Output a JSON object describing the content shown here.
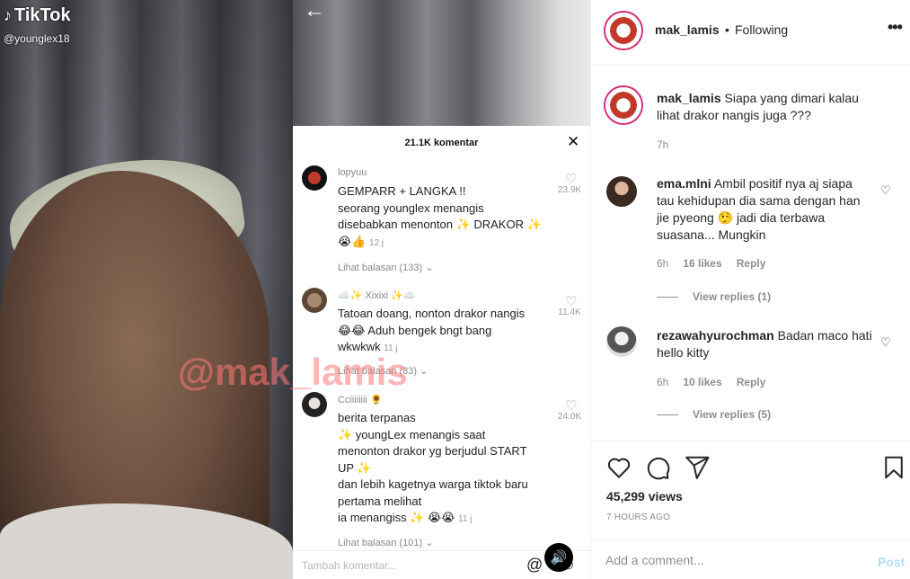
{
  "media": {
    "tiktok": {
      "logo_text": "TikTok",
      "handle": "@younglex18"
    },
    "watermark": "@mak_lamis",
    "comments_panel": {
      "title": "21.1K komentar",
      "close_icon": "close-icon",
      "comments": [
        {
          "username": "lopyuu",
          "lines": [
            "GEMPARR + LANGKA !!",
            "seorang younglex menangis",
            "disebabkan menonton ✨ DRAKOR ✨"
          ],
          "emoji_line": "😭👍",
          "time": "12 j",
          "likes": "23.9K",
          "replies": "Lihat balasan (133)",
          "avatar_color": "#c0392b"
        },
        {
          "username": "☁️✨ Xixixi ✨☁️",
          "lines": [
            "Tatoan doang, nonton drakor nangis",
            "😂😂 Aduh bengek bngt bang",
            "wkwkwk"
          ],
          "emoji_line": "",
          "time": "11 j",
          "likes": "11.4K",
          "replies": "Lihat balasan (83)",
          "avatar_color": "#8a6a55"
        },
        {
          "username": "Cciiiiiiii 🌻",
          "lines": [
            "berita terpanas",
            "✨ youngLex menangis saat",
            "menonton drakor yg berjudul START",
            "UP ✨",
            "dan lebih kagetnya warga tiktok baru",
            "pertama melihat",
            "ia menangiss ✨ 😭😭"
          ],
          "emoji_line": "",
          "time": "11 j",
          "likes": "24.0K",
          "replies": "Lihat balasan (101)",
          "avatar_color": "#333333"
        }
      ],
      "input_placeholder": "Tambah komentar...",
      "at_icon": "at-icon",
      "emoji_icon": "emoji-icon"
    },
    "sound_icon": "speaker-icon"
  },
  "post": {
    "author": "mak_lamis",
    "dot": "•",
    "follow_status": "Following",
    "more_icon": "more-icon",
    "caption": {
      "username": "mak_lamis",
      "text": "Siapa yang dimari kalau lihat drakor nangis juga ???",
      "time": "7h"
    },
    "comments": [
      {
        "username": "ema.mlni",
        "text": "Ambil positif nya aj siapa tau kehidupan dia sama dengan han jie pyeong 🤥 jadi dia terbawa suasana... Mungkin",
        "time": "6h",
        "likes": "16 likes",
        "reply": "Reply",
        "view_replies": "View replies (1)"
      },
      {
        "username": "rezawahyurochman",
        "text": "Badan maco hati hello kitty",
        "time": "6h",
        "likes": "10 likes",
        "reply": "Reply",
        "view_replies": "View replies (5)"
      }
    ],
    "actions": [
      "heart-icon",
      "comment-icon",
      "share-icon",
      "bookmark-icon"
    ],
    "views": "45,299 views",
    "age": "7 HOURS AGO",
    "add_comment_placeholder": "Add a comment...",
    "post_label": "Post",
    "colors": {
      "text": "#262626",
      "secondary": "#8e8e8e",
      "border": "#efefef",
      "post_button": "#b2dffc"
    }
  }
}
